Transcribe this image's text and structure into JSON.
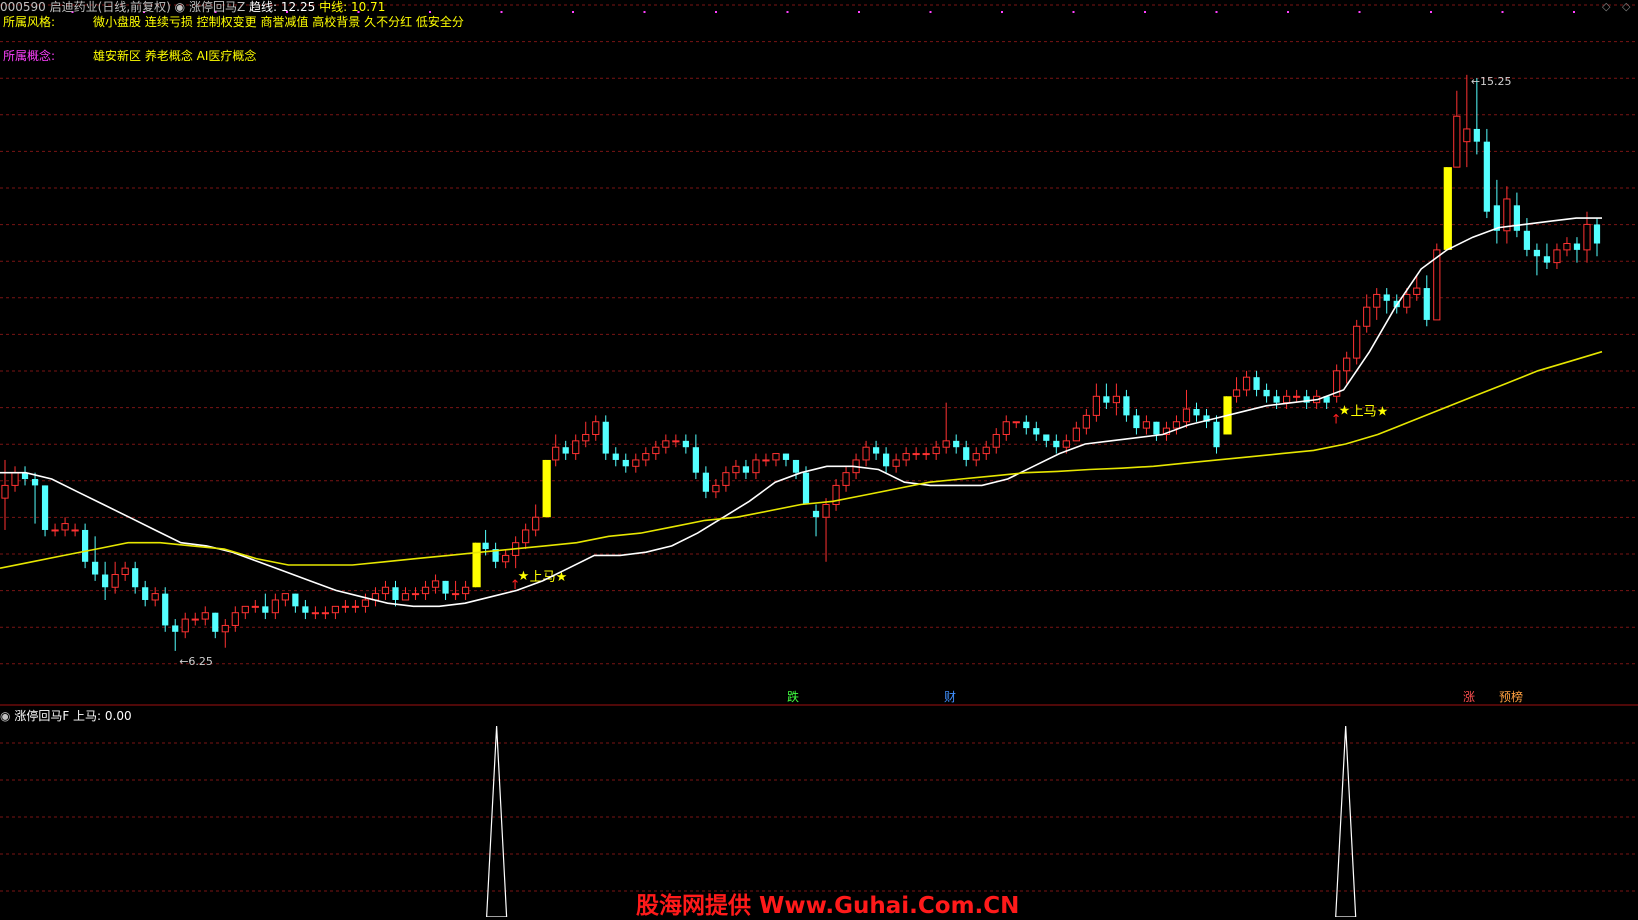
{
  "header": {
    "code": "000590",
    "name": "启迪药业(日线,前复权)",
    "indicator": "涨停回马Z",
    "line1_label": "趋线:",
    "line1_value": "12.25",
    "line2_label": "中线:",
    "line2_value": "10.71"
  },
  "info": {
    "style_label": "所属风格:",
    "style_value": "微小盘股 连续亏损 控制权变更 商誉减值 高校背景 久不分红 低安全分",
    "concept_label": "所属概念:",
    "concept_value": "雄安新区 养老概念 AI医疗概念"
  },
  "price_marks": {
    "high": "15.25",
    "low": "6.25"
  },
  "event_labels": [
    "跌",
    "财",
    "涨",
    "预榜"
  ],
  "signal_label": "上马",
  "sub_header": {
    "indicator": "涨停回马F",
    "label": "上马:",
    "value": "0.00"
  },
  "watermark": "股海网提供 Www.Guhai.Com.CN",
  "colors": {
    "up": "#ff3232",
    "down": "#54ffff",
    "limit": "#ffff00",
    "trend": "#ffffff",
    "mid": "#e6e600",
    "grid": "#7a1414",
    "signal": "#ffffff"
  },
  "chart_data": {
    "type": "candlestick",
    "ylim": [
      5.9,
      16.3
    ],
    "candles": [
      {
        "o": 8.6,
        "h": 9.2,
        "l": 8.1,
        "c": 8.8
      },
      {
        "o": 8.8,
        "h": 9.1,
        "l": 8.7,
        "c": 9.0
      },
      {
        "o": 9.0,
        "h": 9.1,
        "l": 8.8,
        "c": 8.9
      },
      {
        "o": 8.9,
        "h": 9.0,
        "l": 8.2,
        "c": 8.8
      },
      {
        "o": 8.8,
        "h": 8.8,
        "l": 8.0,
        "c": 8.1
      },
      {
        "o": 8.1,
        "h": 8.2,
        "l": 8.0,
        "c": 8.1
      },
      {
        "o": 8.1,
        "h": 8.3,
        "l": 8.0,
        "c": 8.2
      },
      {
        "o": 8.1,
        "h": 8.2,
        "l": 8.0,
        "c": 8.1
      },
      {
        "o": 8.1,
        "h": 8.2,
        "l": 7.5,
        "c": 7.6
      },
      {
        "o": 7.6,
        "h": 8.0,
        "l": 7.3,
        "c": 7.4
      },
      {
        "o": 7.4,
        "h": 7.6,
        "l": 7.0,
        "c": 7.2
      },
      {
        "o": 7.2,
        "h": 7.6,
        "l": 7.1,
        "c": 7.4
      },
      {
        "o": 7.4,
        "h": 7.6,
        "l": 7.3,
        "c": 7.5
      },
      {
        "o": 7.5,
        "h": 7.6,
        "l": 7.1,
        "c": 7.2
      },
      {
        "o": 7.2,
        "h": 7.3,
        "l": 6.9,
        "c": 7.0
      },
      {
        "o": 7.0,
        "h": 7.2,
        "l": 6.9,
        "c": 7.1
      },
      {
        "o": 7.1,
        "h": 7.2,
        "l": 6.5,
        "c": 6.6
      },
      {
        "o": 6.6,
        "h": 6.7,
        "l": 6.2,
        "c": 6.5
      },
      {
        "o": 6.5,
        "h": 6.8,
        "l": 6.4,
        "c": 6.7
      },
      {
        "o": 6.7,
        "h": 6.8,
        "l": 6.6,
        "c": 6.7
      },
      {
        "o": 6.7,
        "h": 6.9,
        "l": 6.6,
        "c": 6.8
      },
      {
        "o": 6.8,
        "h": 6.8,
        "l": 6.4,
        "c": 6.5
      },
      {
        "o": 6.5,
        "h": 6.7,
        "l": 6.25,
        "c": 6.6
      },
      {
        "o": 6.6,
        "h": 6.9,
        "l": 6.5,
        "c": 6.8
      },
      {
        "o": 6.8,
        "h": 6.9,
        "l": 6.7,
        "c": 6.9
      },
      {
        "o": 6.9,
        "h": 7.0,
        "l": 6.8,
        "c": 6.9
      },
      {
        "o": 6.9,
        "h": 7.1,
        "l": 6.7,
        "c": 6.8
      },
      {
        "o": 6.8,
        "h": 7.1,
        "l": 6.7,
        "c": 7.0
      },
      {
        "o": 7.0,
        "h": 7.1,
        "l": 6.9,
        "c": 7.1
      },
      {
        "o": 7.1,
        "h": 7.1,
        "l": 6.8,
        "c": 6.9
      },
      {
        "o": 6.9,
        "h": 7.0,
        "l": 6.7,
        "c": 6.8
      },
      {
        "o": 6.8,
        "h": 6.9,
        "l": 6.7,
        "c": 6.8
      },
      {
        "o": 6.8,
        "h": 6.9,
        "l": 6.7,
        "c": 6.8
      },
      {
        "o": 6.8,
        "h": 6.9,
        "l": 6.7,
        "c": 6.9
      },
      {
        "o": 6.9,
        "h": 7.0,
        "l": 6.8,
        "c": 6.9
      },
      {
        "o": 6.9,
        "h": 7.0,
        "l": 6.8,
        "c": 6.9
      },
      {
        "o": 6.9,
        "h": 7.1,
        "l": 6.8,
        "c": 7.0
      },
      {
        "o": 7.0,
        "h": 7.2,
        "l": 6.9,
        "c": 7.1
      },
      {
        "o": 7.1,
        "h": 7.3,
        "l": 7.0,
        "c": 7.2
      },
      {
        "o": 7.2,
        "h": 7.3,
        "l": 6.9,
        "c": 7.0
      },
      {
        "o": 7.0,
        "h": 7.2,
        "l": 7.0,
        "c": 7.1
      },
      {
        "o": 7.1,
        "h": 7.2,
        "l": 7.0,
        "c": 7.1
      },
      {
        "o": 7.1,
        "h": 7.3,
        "l": 7.0,
        "c": 7.2
      },
      {
        "o": 7.2,
        "h": 7.4,
        "l": 7.1,
        "c": 7.3
      },
      {
        "o": 7.3,
        "h": 7.3,
        "l": 7.0,
        "c": 7.1
      },
      {
        "o": 7.1,
        "h": 7.3,
        "l": 7.0,
        "c": 7.1
      },
      {
        "o": 7.1,
        "h": 7.3,
        "l": 7.0,
        "c": 7.2
      },
      {
        "o": 7.2,
        "h": 7.9,
        "l": 7.2,
        "c": 7.9,
        "limit": true
      },
      {
        "o": 7.9,
        "h": 8.1,
        "l": 7.7,
        "c": 7.8
      },
      {
        "o": 7.8,
        "h": 7.9,
        "l": 7.5,
        "c": 7.6
      },
      {
        "o": 7.6,
        "h": 7.8,
        "l": 7.5,
        "c": 7.7
      },
      {
        "o": 7.7,
        "h": 8.0,
        "l": 7.5,
        "c": 7.9,
        "mark": true
      },
      {
        "o": 7.9,
        "h": 8.2,
        "l": 7.8,
        "c": 8.1
      },
      {
        "o": 8.1,
        "h": 8.5,
        "l": 8.0,
        "c": 8.3
      },
      {
        "o": 8.3,
        "h": 9.2,
        "l": 8.3,
        "c": 9.2,
        "limit": true
      },
      {
        "o": 9.2,
        "h": 9.6,
        "l": 9.1,
        "c": 9.4
      },
      {
        "o": 9.4,
        "h": 9.5,
        "l": 9.2,
        "c": 9.3
      },
      {
        "o": 9.3,
        "h": 9.6,
        "l": 9.2,
        "c": 9.5
      },
      {
        "o": 9.5,
        "h": 9.8,
        "l": 9.4,
        "c": 9.6
      },
      {
        "o": 9.6,
        "h": 9.9,
        "l": 9.5,
        "c": 9.8
      },
      {
        "o": 9.8,
        "h": 9.9,
        "l": 9.2,
        "c": 9.3
      },
      {
        "o": 9.3,
        "h": 9.4,
        "l": 9.1,
        "c": 9.2
      },
      {
        "o": 9.2,
        "h": 9.3,
        "l": 9.0,
        "c": 9.1
      },
      {
        "o": 9.1,
        "h": 9.3,
        "l": 9.0,
        "c": 9.2
      },
      {
        "o": 9.2,
        "h": 9.4,
        "l": 9.1,
        "c": 9.3
      },
      {
        "o": 9.3,
        "h": 9.5,
        "l": 9.2,
        "c": 9.4
      },
      {
        "o": 9.4,
        "h": 9.6,
        "l": 9.3,
        "c": 9.5
      },
      {
        "o": 9.5,
        "h": 9.6,
        "l": 9.4,
        "c": 9.5
      },
      {
        "o": 9.5,
        "h": 9.6,
        "l": 9.3,
        "c": 9.4
      },
      {
        "o": 9.4,
        "h": 9.6,
        "l": 8.9,
        "c": 9.0
      },
      {
        "o": 9.0,
        "h": 9.1,
        "l": 8.6,
        "c": 8.7
      },
      {
        "o": 8.7,
        "h": 8.9,
        "l": 8.6,
        "c": 8.8
      },
      {
        "o": 8.8,
        "h": 9.1,
        "l": 8.7,
        "c": 9.0
      },
      {
        "o": 9.0,
        "h": 9.2,
        "l": 8.9,
        "c": 9.1
      },
      {
        "o": 9.1,
        "h": 9.2,
        "l": 8.9,
        "c": 9.0
      },
      {
        "o": 9.0,
        "h": 9.3,
        "l": 8.9,
        "c": 9.2
      },
      {
        "o": 9.2,
        "h": 9.3,
        "l": 9.1,
        "c": 9.2
      },
      {
        "o": 9.2,
        "h": 9.3,
        "l": 9.1,
        "c": 9.3
      },
      {
        "o": 9.3,
        "h": 9.3,
        "l": 9.1,
        "c": 9.2
      },
      {
        "o": 9.2,
        "h": 9.2,
        "l": 8.9,
        "c": 9.0
      },
      {
        "o": 9.0,
        "h": 9.1,
        "l": 8.5,
        "c": 8.5
      },
      {
        "o": 8.4,
        "h": 8.5,
        "l": 8.0,
        "c": 8.3
      },
      {
        "o": 8.3,
        "h": 8.6,
        "l": 7.6,
        "c": 8.5
      },
      {
        "o": 8.5,
        "h": 8.9,
        "l": 8.4,
        "c": 8.8
      },
      {
        "o": 8.8,
        "h": 9.1,
        "l": 8.7,
        "c": 9.0
      },
      {
        "o": 9.0,
        "h": 9.3,
        "l": 8.9,
        "c": 9.2
      },
      {
        "o": 9.2,
        "h": 9.5,
        "l": 9.1,
        "c": 9.4
      },
      {
        "o": 9.4,
        "h": 9.5,
        "l": 9.2,
        "c": 9.3
      },
      {
        "o": 9.3,
        "h": 9.4,
        "l": 9.0,
        "c": 9.1
      },
      {
        "o": 9.1,
        "h": 9.3,
        "l": 9.0,
        "c": 9.2
      },
      {
        "o": 9.2,
        "h": 9.4,
        "l": 9.1,
        "c": 9.3
      },
      {
        "o": 9.3,
        "h": 9.4,
        "l": 9.2,
        "c": 9.3
      },
      {
        "o": 9.3,
        "h": 9.4,
        "l": 9.2,
        "c": 9.3
      },
      {
        "o": 9.3,
        "h": 9.5,
        "l": 9.2,
        "c": 9.4
      },
      {
        "o": 9.4,
        "h": 10.1,
        "l": 9.3,
        "c": 9.5
      },
      {
        "o": 9.5,
        "h": 9.6,
        "l": 9.3,
        "c": 9.4
      },
      {
        "o": 9.4,
        "h": 9.5,
        "l": 9.1,
        "c": 9.2
      },
      {
        "o": 9.2,
        "h": 9.4,
        "l": 9.1,
        "c": 9.3
      },
      {
        "o": 9.3,
        "h": 9.5,
        "l": 9.2,
        "c": 9.4
      },
      {
        "o": 9.4,
        "h": 9.7,
        "l": 9.3,
        "c": 9.6
      },
      {
        "o": 9.6,
        "h": 9.9,
        "l": 9.5,
        "c": 9.8
      },
      {
        "o": 9.8,
        "h": 9.8,
        "l": 9.7,
        "c": 9.8
      },
      {
        "o": 9.8,
        "h": 9.9,
        "l": 9.6,
        "c": 9.7
      },
      {
        "o": 9.7,
        "h": 9.8,
        "l": 9.5,
        "c": 9.6
      },
      {
        "o": 9.6,
        "h": 9.6,
        "l": 9.4,
        "c": 9.5
      },
      {
        "o": 9.5,
        "h": 9.6,
        "l": 9.3,
        "c": 9.4
      },
      {
        "o": 9.4,
        "h": 9.6,
        "l": 9.3,
        "c": 9.5
      },
      {
        "o": 9.5,
        "h": 9.8,
        "l": 9.5,
        "c": 9.7
      },
      {
        "o": 9.7,
        "h": 10.0,
        "l": 9.6,
        "c": 9.9
      },
      {
        "o": 9.9,
        "h": 10.4,
        "l": 9.8,
        "c": 10.2
      },
      {
        "o": 10.2,
        "h": 10.4,
        "l": 10.0,
        "c": 10.1
      },
      {
        "o": 10.1,
        "h": 10.4,
        "l": 9.9,
        "c": 10.2
      },
      {
        "o": 10.2,
        "h": 10.3,
        "l": 9.8,
        "c": 9.9
      },
      {
        "o": 9.9,
        "h": 10.0,
        "l": 9.6,
        "c": 9.7
      },
      {
        "o": 9.7,
        "h": 9.9,
        "l": 9.6,
        "c": 9.8
      },
      {
        "o": 9.8,
        "h": 9.8,
        "l": 9.5,
        "c": 9.6
      },
      {
        "o": 9.6,
        "h": 9.8,
        "l": 9.5,
        "c": 9.7
      },
      {
        "o": 9.7,
        "h": 9.9,
        "l": 9.6,
        "c": 9.8
      },
      {
        "o": 9.8,
        "h": 10.3,
        "l": 9.7,
        "c": 10.0
      },
      {
        "o": 10.0,
        "h": 10.1,
        "l": 9.8,
        "c": 9.9
      },
      {
        "o": 9.9,
        "h": 10.0,
        "l": 9.7,
        "c": 9.8
      },
      {
        "o": 9.8,
        "h": 9.9,
        "l": 9.3,
        "c": 9.4
      },
      {
        "o": 9.6,
        "h": 10.2,
        "l": 9.6,
        "c": 10.2,
        "limit": true
      },
      {
        "o": 10.2,
        "h": 10.5,
        "l": 10.1,
        "c": 10.3
      },
      {
        "o": 10.3,
        "h": 10.6,
        "l": 10.2,
        "c": 10.5
      },
      {
        "o": 10.5,
        "h": 10.6,
        "l": 10.2,
        "c": 10.3
      },
      {
        "o": 10.3,
        "h": 10.4,
        "l": 10.1,
        "c": 10.2
      },
      {
        "o": 10.2,
        "h": 10.3,
        "l": 10.0,
        "c": 10.1
      },
      {
        "o": 10.1,
        "h": 10.3,
        "l": 10.0,
        "c": 10.2
      },
      {
        "o": 10.2,
        "h": 10.3,
        "l": 10.1,
        "c": 10.2
      },
      {
        "o": 10.2,
        "h": 10.3,
        "l": 10.0,
        "c": 10.1
      },
      {
        "o": 10.1,
        "h": 10.3,
        "l": 10.0,
        "c": 10.2
      },
      {
        "o": 10.2,
        "h": 10.2,
        "l": 10.0,
        "c": 10.1
      },
      {
        "o": 10.2,
        "h": 10.7,
        "l": 10.1,
        "c": 10.6,
        "mark": true
      },
      {
        "o": 10.6,
        "h": 10.9,
        "l": 10.4,
        "c": 10.8
      },
      {
        "o": 10.8,
        "h": 11.4,
        "l": 10.7,
        "c": 11.3
      },
      {
        "o": 11.3,
        "h": 11.8,
        "l": 11.2,
        "c": 11.6
      },
      {
        "o": 11.6,
        "h": 11.9,
        "l": 11.4,
        "c": 11.8
      },
      {
        "o": 11.8,
        "h": 11.9,
        "l": 11.5,
        "c": 11.7
      },
      {
        "o": 11.7,
        "h": 11.8,
        "l": 11.5,
        "c": 11.6
      },
      {
        "o": 11.6,
        "h": 11.9,
        "l": 11.5,
        "c": 11.8
      },
      {
        "o": 11.8,
        "h": 12.1,
        "l": 11.7,
        "c": 11.9
      },
      {
        "o": 11.9,
        "h": 12.1,
        "l": 11.3,
        "c": 11.4
      },
      {
        "o": 11.4,
        "h": 12.6,
        "l": 11.4,
        "c": 12.5
      },
      {
        "o": 12.5,
        "h": 13.8,
        "l": 12.5,
        "c": 13.8,
        "limit": true
      },
      {
        "o": 13.8,
        "h": 15.0,
        "l": 13.8,
        "c": 14.6
      },
      {
        "o": 14.2,
        "h": 15.25,
        "l": 13.8,
        "c": 14.4
      },
      {
        "o": 14.4,
        "h": 15.2,
        "l": 14.0,
        "c": 14.2
      },
      {
        "o": 14.2,
        "h": 14.4,
        "l": 13.0,
        "c": 13.1
      },
      {
        "o": 13.2,
        "h": 13.6,
        "l": 12.6,
        "c": 12.8
      },
      {
        "o": 12.8,
        "h": 13.5,
        "l": 12.6,
        "c": 13.3
      },
      {
        "o": 13.2,
        "h": 13.4,
        "l": 12.7,
        "c": 12.8
      },
      {
        "o": 12.8,
        "h": 13.0,
        "l": 12.4,
        "c": 12.5
      },
      {
        "o": 12.5,
        "h": 12.6,
        "l": 12.1,
        "c": 12.4
      },
      {
        "o": 12.4,
        "h": 12.6,
        "l": 12.2,
        "c": 12.3
      },
      {
        "o": 12.3,
        "h": 12.6,
        "l": 12.2,
        "c": 12.5
      },
      {
        "o": 12.5,
        "h": 12.7,
        "l": 12.4,
        "c": 12.6
      },
      {
        "o": 12.6,
        "h": 12.7,
        "l": 12.3,
        "c": 12.5
      },
      {
        "o": 12.5,
        "h": 13.1,
        "l": 12.3,
        "c": 12.9
      },
      {
        "o": 12.9,
        "h": 13.0,
        "l": 12.4,
        "c": 12.6
      }
    ],
    "trend_line": [
      9.0,
      9.0,
      8.9,
      8.7,
      8.5,
      8.3,
      8.1,
      7.9,
      7.85,
      7.75,
      7.6,
      7.45,
      7.3,
      7.15,
      7.05,
      6.95,
      6.9,
      6.9,
      6.95,
      7.05,
      7.15,
      7.3,
      7.5,
      7.7,
      7.7,
      7.75,
      7.85,
      8.05,
      8.3,
      8.55,
      8.85,
      9.0,
      9.1,
      9.1,
      9.05,
      8.85,
      8.8,
      8.8,
      8.8,
      8.9,
      9.1,
      9.3,
      9.45,
      9.5,
      9.55,
      9.6,
      9.75,
      9.85,
      9.95,
      10.05,
      10.1,
      10.15,
      10.3,
      10.9,
      11.6,
      12.2,
      12.5,
      12.7,
      12.85,
      12.9,
      12.95,
      13.0,
      13.0
    ],
    "mid_line": [
      7.5,
      7.6,
      7.7,
      7.8,
      7.9,
      7.9,
      7.85,
      7.8,
      7.65,
      7.55,
      7.55,
      7.55,
      7.6,
      7.65,
      7.7,
      7.75,
      7.8,
      7.85,
      7.9,
      8.0,
      8.05,
      8.15,
      8.25,
      8.3,
      8.4,
      8.5,
      8.55,
      8.65,
      8.75,
      8.85,
      8.9,
      8.95,
      9.0,
      9.02,
      9.05,
      9.07,
      9.1,
      9.15,
      9.2,
      9.25,
      9.3,
      9.35,
      9.45,
      9.6,
      9.8,
      10.0,
      10.2,
      10.4,
      10.6,
      10.75,
      10.9
    ],
    "signal_series": {
      "peaks": [
        0.31,
        0.84
      ],
      "values": [
        0,
        0
      ]
    }
  }
}
